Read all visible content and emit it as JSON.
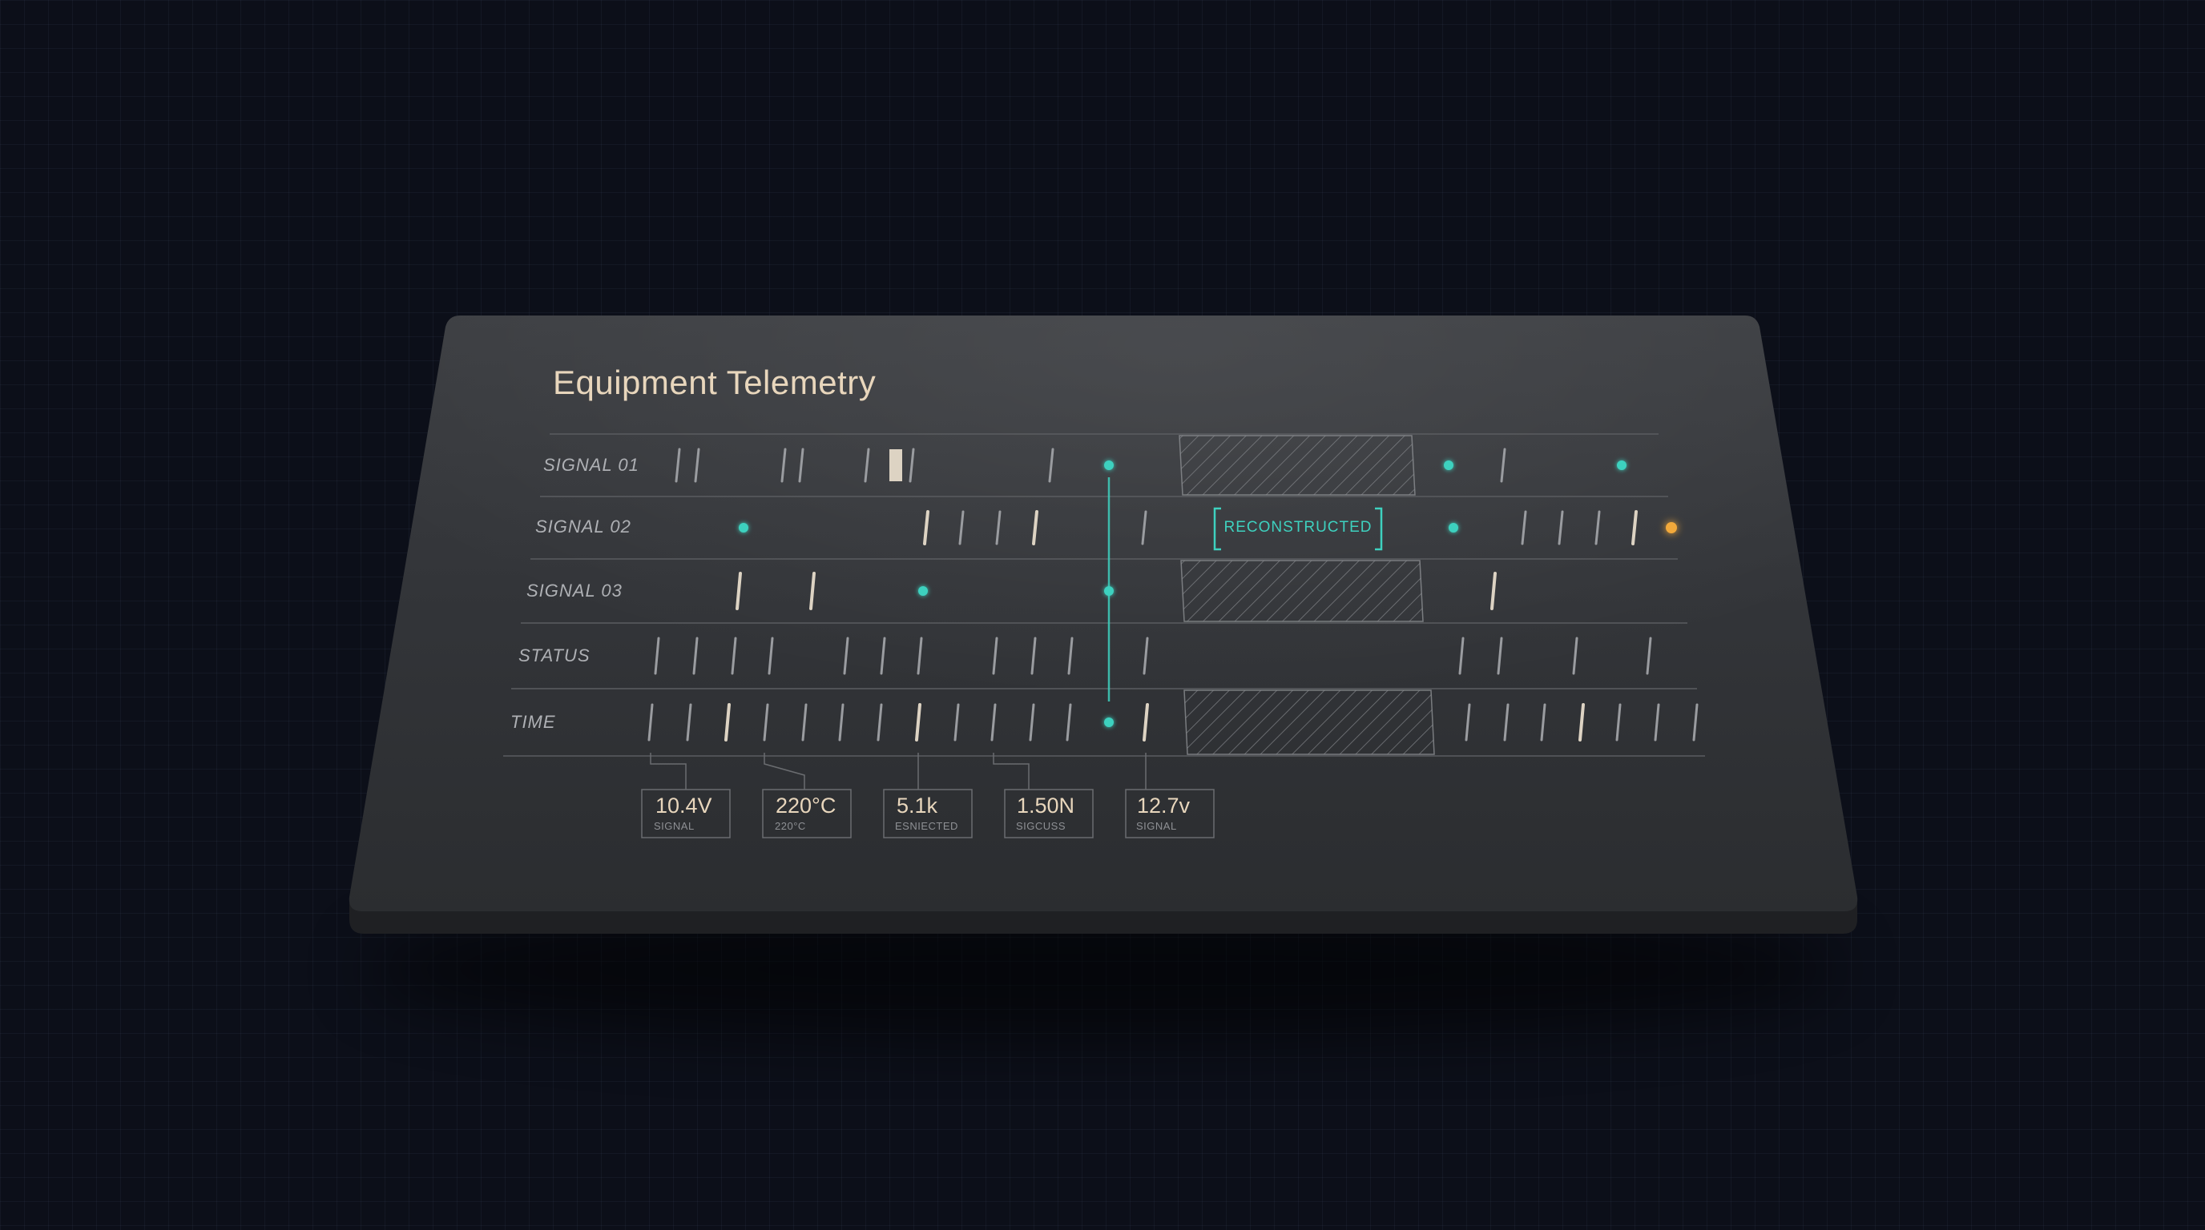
{
  "panel": {
    "title": "Equipment Telemetry",
    "colors": {
      "background": "#0c0f19",
      "panel": "#333539",
      "title": "#e8d6bc",
      "label": "#aeb0b4",
      "tick": "#9a9ca0",
      "tick_bright": "#ddd3c3",
      "accent_teal": "#3ed1bf",
      "accent_orange": "#f2a93b",
      "hatch": "#8c8e92"
    }
  },
  "tracks": [
    {
      "label": "SIGNAL 01"
    },
    {
      "label": "SIGNAL 02"
    },
    {
      "label": "SIGNAL 03"
    },
    {
      "label": "STATUS"
    },
    {
      "label": "TIME"
    }
  ],
  "reconstructed_label": "RECONSTRUCTED",
  "readouts": [
    {
      "value": "10.4V",
      "caption": "SIGNAL"
    },
    {
      "value": "220°C",
      "caption": "220°C"
    },
    {
      "value": "5.1k",
      "caption": "ESNIECTED"
    },
    {
      "value": "1.50N",
      "caption": "SIGCUSS"
    },
    {
      "value": "12.7v",
      "caption": "SIGNAL"
    }
  ],
  "icons": {
    "teal_marker": "teal-dot-icon",
    "orange_marker": "orange-dot-icon",
    "bracket": "bracket-corner-icon"
  }
}
